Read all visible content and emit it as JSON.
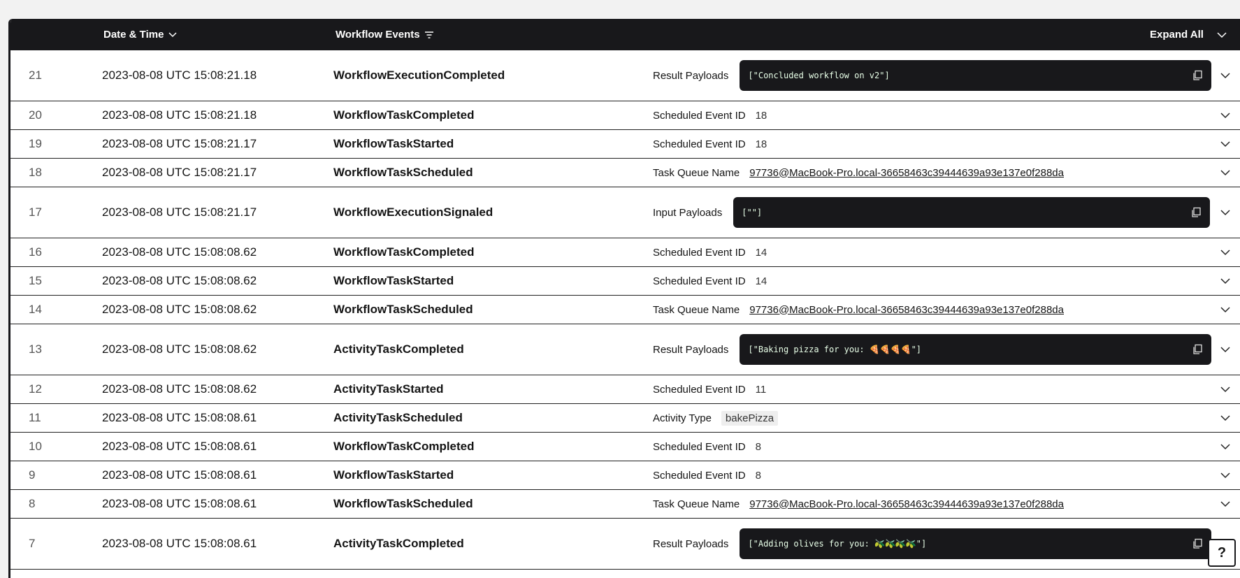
{
  "header": {
    "date_label": "Date & Time",
    "events_label": "Workflow Events",
    "expand_label": "Expand All"
  },
  "rows": [
    {
      "num": "21",
      "date": "2023-08-08 UTC 15:08:21.18",
      "event": "WorkflowExecutionCompleted",
      "label": "Result Payloads",
      "value": "[\"Concluded workflow on v2\"]",
      "kind": "code"
    },
    {
      "num": "20",
      "date": "2023-08-08 UTC 15:08:21.18",
      "event": "WorkflowTaskCompleted",
      "label": "Scheduled Event ID",
      "value": "18",
      "kind": "text"
    },
    {
      "num": "19",
      "date": "2023-08-08 UTC 15:08:21.17",
      "event": "WorkflowTaskStarted",
      "label": "Scheduled Event ID",
      "value": "18",
      "kind": "text"
    },
    {
      "num": "18",
      "date": "2023-08-08 UTC 15:08:21.17",
      "event": "WorkflowTaskScheduled",
      "label": "Task Queue Name",
      "value": "97736@MacBook-Pro.local-36658463c39444639a93e137e0f288da",
      "kind": "link"
    },
    {
      "num": "17",
      "date": "2023-08-08 UTC 15:08:21.17",
      "event": "WorkflowExecutionSignaled",
      "label": "Input Payloads",
      "value": "[\"\"]",
      "kind": "code"
    },
    {
      "num": "16",
      "date": "2023-08-08 UTC 15:08:08.62",
      "event": "WorkflowTaskCompleted",
      "label": "Scheduled Event ID",
      "value": "14",
      "kind": "text"
    },
    {
      "num": "15",
      "date": "2023-08-08 UTC 15:08:08.62",
      "event": "WorkflowTaskStarted",
      "label": "Scheduled Event ID",
      "value": "14",
      "kind": "text"
    },
    {
      "num": "14",
      "date": "2023-08-08 UTC 15:08:08.62",
      "event": "WorkflowTaskScheduled",
      "label": "Task Queue Name",
      "value": "97736@MacBook-Pro.local-36658463c39444639a93e137e0f288da",
      "kind": "link"
    },
    {
      "num": "13",
      "date": "2023-08-08 UTC 15:08:08.62",
      "event": "ActivityTaskCompleted",
      "label": "Result Payloads",
      "value": "[\"Baking pizza for you: 🍕🍕🍕🍕\"]",
      "kind": "code"
    },
    {
      "num": "12",
      "date": "2023-08-08 UTC 15:08:08.62",
      "event": "ActivityTaskStarted",
      "label": "Scheduled Event ID",
      "value": "11",
      "kind": "text"
    },
    {
      "num": "11",
      "date": "2023-08-08 UTC 15:08:08.61",
      "event": "ActivityTaskScheduled",
      "label": "Activity Type",
      "value": "bakePizza",
      "kind": "tag"
    },
    {
      "num": "10",
      "date": "2023-08-08 UTC 15:08:08.61",
      "event": "WorkflowTaskCompleted",
      "label": "Scheduled Event ID",
      "value": "8",
      "kind": "text"
    },
    {
      "num": "9",
      "date": "2023-08-08 UTC 15:08:08.61",
      "event": "WorkflowTaskStarted",
      "label": "Scheduled Event ID",
      "value": "8",
      "kind": "text"
    },
    {
      "num": "8",
      "date": "2023-08-08 UTC 15:08:08.61",
      "event": "WorkflowTaskScheduled",
      "label": "Task Queue Name",
      "value": "97736@MacBook-Pro.local-36658463c39444639a93e137e0f288da",
      "kind": "link"
    },
    {
      "num": "7",
      "date": "2023-08-08 UTC 15:08:08.61",
      "event": "ActivityTaskCompleted",
      "label": "Result Payloads",
      "value": "[\"Adding olives for you: 🫒🫒🫒🫒\"]",
      "kind": "code"
    }
  ],
  "help_label": "?",
  "icons": {
    "sort": "chevron-down-icon",
    "filter": "filter-icon",
    "copy": "copy-icon",
    "row_toggle": "chevron-down-icon"
  }
}
